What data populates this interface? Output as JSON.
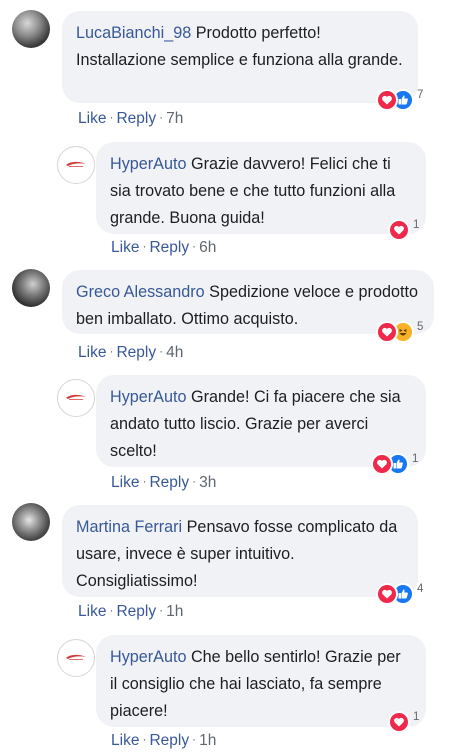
{
  "comments": [
    {
      "author": "LucaBianchi_98",
      "text": " Prodotto perfetto! Installazione semplice e funziona alla grande.",
      "like": "Like",
      "reply": "Reply",
      "time": "7h",
      "reaction_count": "7",
      "reactions": [
        "love-icon",
        "like-icon"
      ]
    },
    {
      "author": "HyperAuto",
      "text": " Grazie davvero! Felici che ti sia trovato bene e che tutto funzioni alla grande. Buona guida!",
      "like": "Like",
      "reply": "Reply",
      "time": "6h",
      "reaction_count": "1",
      "reactions": [
        "love-icon"
      ]
    },
    {
      "author": "Greco Alessandro",
      "text": " Spedizione veloce e prodotto ben imballato. Ottimo acquisto.",
      "like": "Like",
      "reply": "Reply",
      "time": "4h",
      "reaction_count": "5",
      "reactions": [
        "love-icon",
        "haha-icon"
      ]
    },
    {
      "author": "HyperAuto",
      "text": " Grande! Ci fa piacere che sia andato tutto liscio. Grazie per averci scelto!",
      "like": "Like",
      "reply": "Reply",
      "time": "3h",
      "reaction_count": "1",
      "reactions": [
        "love-icon",
        "like-icon"
      ]
    },
    {
      "author": "Martina Ferrari",
      "text": " Pensavo fosse complicato da usare, invece è super intuitivo. Consigliatissimo!",
      "like": "Like",
      "reply": "Reply",
      "time": "1h",
      "reaction_count": "4",
      "reactions": [
        "love-icon",
        "like-icon"
      ]
    },
    {
      "author": "HyperAuto",
      "text": " Che bello sentirlo! Grazie per il consiglio che hai lasciato, fa sempre piacere!",
      "like": "Like",
      "reply": "Reply",
      "time": "1h",
      "reaction_count": "1",
      "reactions": [
        "love-icon"
      ]
    }
  ],
  "separator": "·",
  "colors": {
    "link": "#385898",
    "bubble": "#f0f2f5",
    "love": "#f0284a",
    "like": "#1877f2",
    "haha": "#f7b125"
  }
}
